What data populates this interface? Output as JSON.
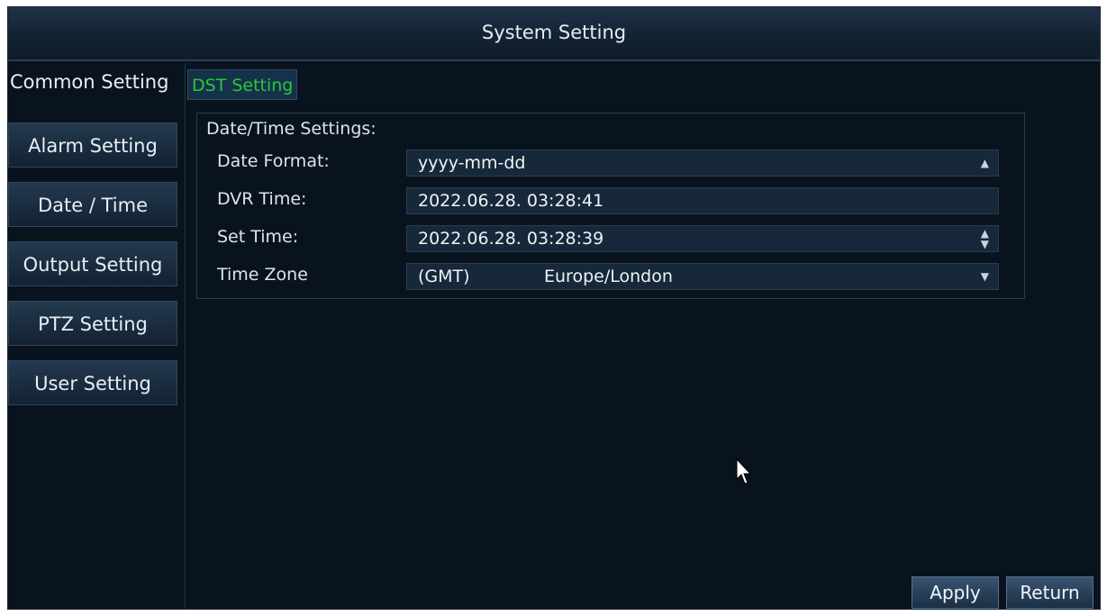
{
  "window": {
    "title": "System Setting"
  },
  "sidebar": {
    "items": [
      {
        "label": "Common Setting",
        "active": true
      },
      {
        "label": "Alarm Setting"
      },
      {
        "label": "Date / Time"
      },
      {
        "label": "Output Setting"
      },
      {
        "label": "PTZ Setting"
      },
      {
        "label": "User Setting"
      }
    ]
  },
  "main": {
    "subtab_label": "DST Setting",
    "group_title": "Date/Time Settings:",
    "date_format": {
      "label": "Date Format:",
      "value": "yyyy-mm-dd",
      "control": "dropdown"
    },
    "dvr_time": {
      "label": "DVR Time:",
      "value": "2022.06.28. 03:28:41"
    },
    "set_time": {
      "label": "Set Time:",
      "value": "2022.06.28. 03:28:39",
      "control": "spinner"
    },
    "time_zone": {
      "label": "Time Zone",
      "offset": "(GMT)",
      "name": "Europe/London",
      "control": "dropdown"
    }
  },
  "buttons": {
    "apply_label": "Apply",
    "return_label": "Return"
  },
  "colors": {
    "background": "#09131e",
    "active_tab_text": "#27c93a",
    "text": "#dde5ec"
  }
}
